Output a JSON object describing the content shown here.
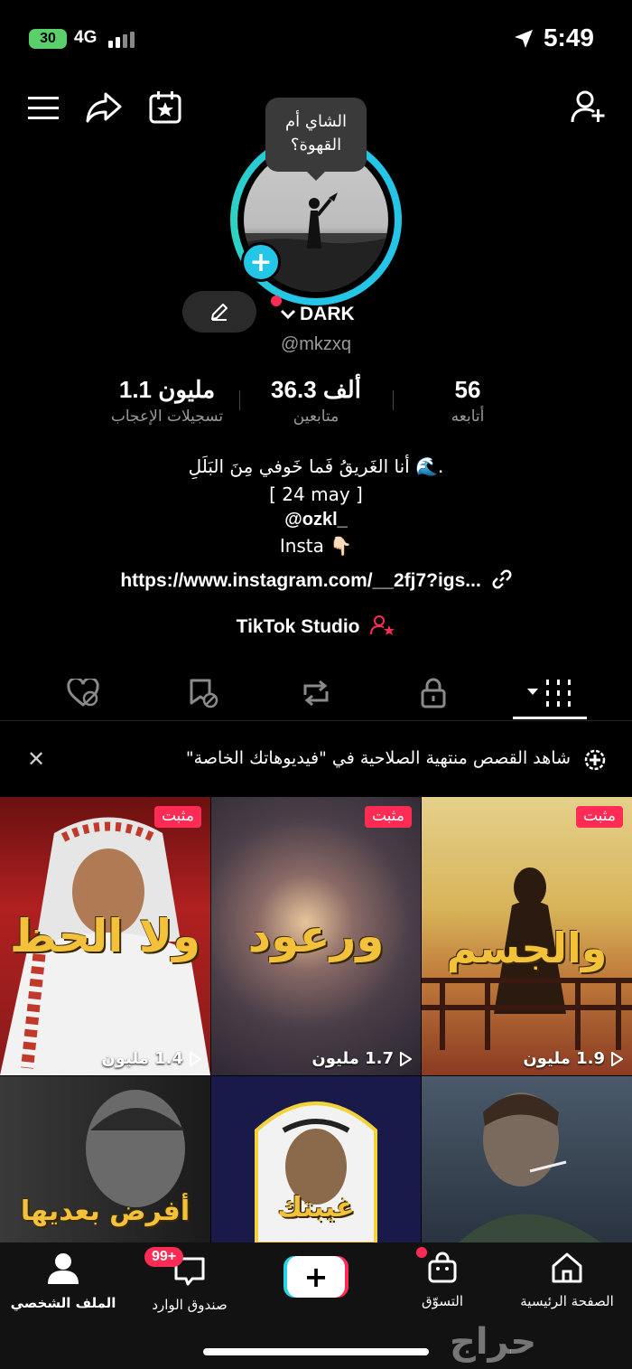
{
  "status_bar": {
    "battery": "30",
    "network": "4G",
    "time": "5:49"
  },
  "profile": {
    "bubble_text": "الشاي أم القهوة؟",
    "display_name": "DARK",
    "handle": "@mkzxq",
    "stats": [
      {
        "value": "1.1 مليون",
        "label": "تسجيلات الإعجاب"
      },
      {
        "value": "36.3 ألف",
        "label": "متابعين"
      },
      {
        "value": "56",
        "label": "أتابعه"
      }
    ],
    "bio_lines": [
      "أنا الغَريقُ فَما خَوفي مِنَ البَلَلِ 🌊.",
      "[ 24 may ]",
      "@ozkl_",
      "Insta 👇🏻"
    ],
    "link": "https://www.instagram.com/__2fj7?igs...",
    "studio": "TikTok Studio"
  },
  "tabs": [
    "videos-grid",
    "private",
    "reposts",
    "favorites",
    "liked"
  ],
  "banner": {
    "text": "شاهد القصص منتهية الصلاحية في \"فيديوهاتك الخاصة\""
  },
  "videos": [
    {
      "pinned": "مثبت",
      "views": "1.9 مليون",
      "overlay": "والجسم"
    },
    {
      "pinned": "مثبت",
      "views": "1.7 مليون",
      "overlay": "ورعود"
    },
    {
      "pinned": "مثبت",
      "views": "1.4 مليون",
      "overlay": "ولا الحظ"
    },
    {
      "overlay": ""
    },
    {
      "overlay": "غيبتك"
    },
    {
      "overlay": "أفرض بعديها"
    }
  ],
  "nav": {
    "home": "الصفحة الرئيسية",
    "shop": "التسوّق",
    "inbox": "صندوق الوارد",
    "inbox_badge": "99+",
    "profile": "الملف الشخصي"
  },
  "watermark": "حراج",
  "colors": {
    "accent": "#fe2c55",
    "cyan": "#23c6e6",
    "overlay_text": "#f3c23a"
  }
}
